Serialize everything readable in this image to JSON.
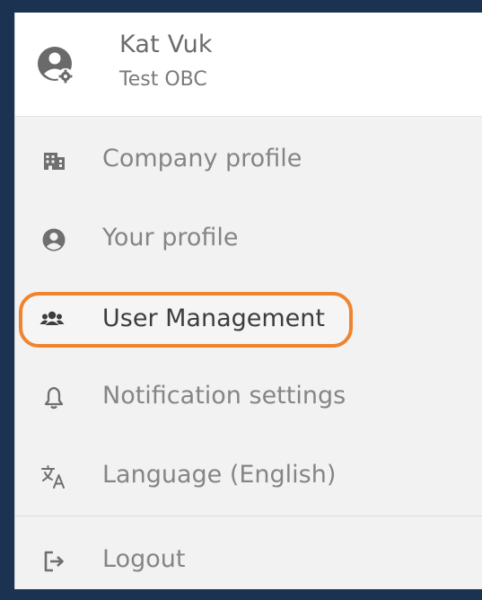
{
  "user": {
    "name": "Kat Vuk",
    "organization": "Test OBC",
    "avatar_icon": "user-gear-icon"
  },
  "menu": {
    "items": [
      {
        "label": "Company profile",
        "icon": "building-icon"
      },
      {
        "label": "Your profile",
        "icon": "user-circle-icon"
      },
      {
        "label": "User Management",
        "icon": "users-group-icon",
        "highlighted": true
      },
      {
        "label": "Notification settings",
        "icon": "bell-icon"
      },
      {
        "label": "Language (English)",
        "icon": "translate-icon"
      }
    ],
    "logout": {
      "label": "Logout",
      "icon": "logout-icon"
    }
  },
  "colors": {
    "background": "#1b3350",
    "highlight": "#f0842e",
    "icon": "#6f6f6f",
    "text": "#858585"
  }
}
